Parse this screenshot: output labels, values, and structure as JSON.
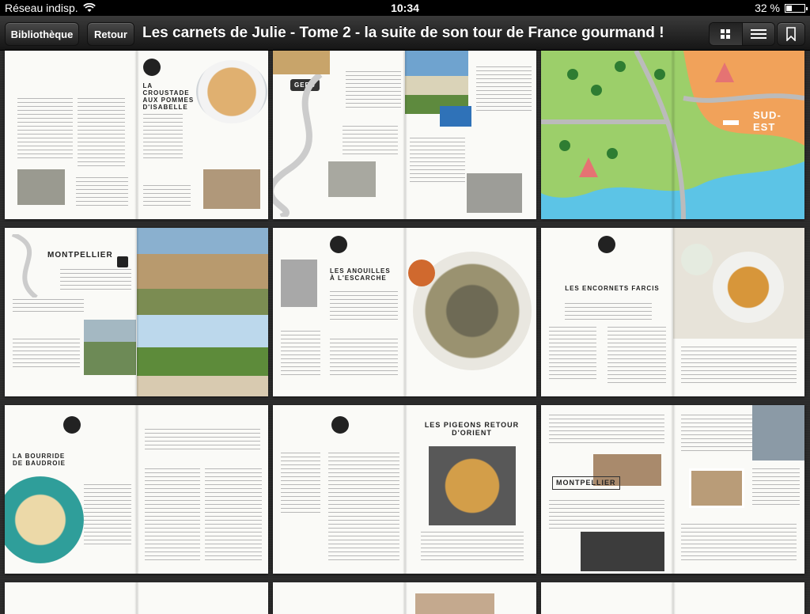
{
  "status_bar": {
    "network": "Réseau indisp.",
    "time": "10:34",
    "battery": "32 %",
    "battery_level": 0.32
  },
  "toolbar": {
    "library_label": "Bibliothèque",
    "back_label": "Retour",
    "title": "Les carnets de Julie - Tome 2 - la suite de son tour de France gourmand !"
  },
  "pages": [
    {
      "title": "LA CROUSTADE AUX POMMES D'ISABELLE"
    },
    {
      "title": "GERS"
    },
    {
      "title": "SUD-EST"
    },
    {
      "title": "MONTPELLIER"
    },
    {
      "title": "LES ANOUILLES À L'ESCARCHE"
    },
    {
      "title": "LES ENCORNETS FARCIS"
    },
    {
      "title": "LA BOURRIDE DE BAUDROIE"
    },
    {
      "title": "LES PIGEONS RETOUR D'ORIENT"
    },
    {
      "title": "MONTPELLIER"
    }
  ]
}
